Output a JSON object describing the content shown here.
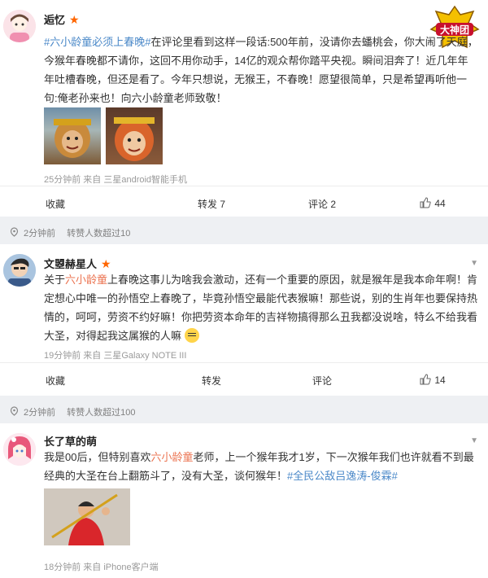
{
  "post1": {
    "username": "逅忆",
    "tag_link": "#六小龄童必须上春晚#",
    "body": "在评论里看到这样一段话:500年前，没请你去蟠桃会，你大闹了天庭，今猴年春晚都不请你，这回不用你动手，14亿的观众帮你踏平央视。瞬间泪奔了！近几年年年吐槽春晚，但还是看了。今年只想说，无猴王，不春晚！愿望很简单，只是希望再听他一句:俺老孙来也！向六小龄童老师致敬！",
    "meta": "25分钟前 来自 三星android智能手机",
    "actions": {
      "fav": "收藏",
      "repost": "转发 7",
      "comment": "评论 2",
      "like": "44"
    }
  },
  "repost_bar1": {
    "time": "2分钟前",
    "text": "转赞人数超过10"
  },
  "post2": {
    "username": "文曌赫星人",
    "mention": "六小龄童",
    "body_pre": "关于",
    "body_post": "上春晚这事儿为啥我会激动，还有一个重要的原因，就是猴年是我本命年啊！肯定想心中唯一的孙悟空上春晚了，毕竟孙悟空最能代表猴嘛！那些说，别的生肖年也要保持热情的，呵呵，劳资不约好嘛！你把劳资本命年的吉祥物搞得那么丑我都没说啥，特么不给我看大圣，对得起我这属猴的人嘛",
    "meta": "19分钟前 来自 三星Galaxy NOTE III",
    "actions": {
      "fav": "收藏",
      "repost": "转发",
      "comment": "评论",
      "like": "14"
    }
  },
  "repost_bar2": {
    "time": "2分钟前",
    "text": "转赞人数超过100"
  },
  "post3": {
    "username": "长了草的萌",
    "mention": "六小龄童",
    "body_pre": "我是00后，但特别喜欢",
    "body_post": "老师，上一个猴年我才1岁，下一次猴年我们也许就看不到最经典的大圣在台上翻筋斗了，没有大圣，谈何猴年！",
    "tag_link": "#全民公敌吕逸涛-俊霖#",
    "meta": "18分钟前 来自 iPhone客户端"
  },
  "logo_text": "大神团",
  "colors": {
    "accent": "#eb7350",
    "link": "#4a88c8",
    "star": "#ff6600"
  }
}
